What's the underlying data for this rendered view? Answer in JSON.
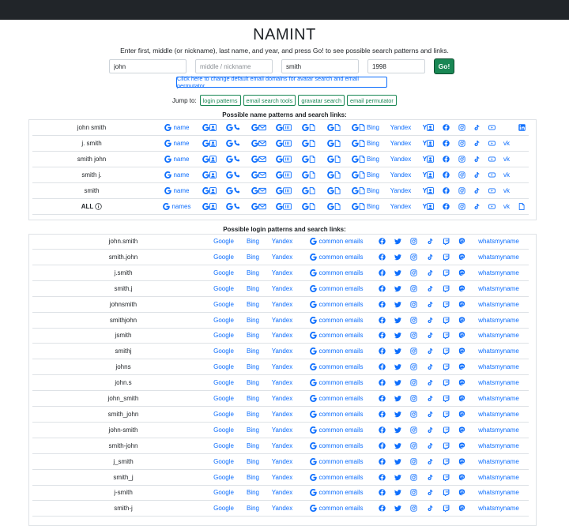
{
  "app": {
    "title": "NAMINT",
    "instructions": "Enter first, middle (or nickname), last name, and year, and press Go! to see possible search patterns and links."
  },
  "form": {
    "first": {
      "value": "john"
    },
    "middle": {
      "value": "",
      "placeholder": "middle / nickname"
    },
    "last": {
      "value": "smith"
    },
    "year": {
      "value": "1998"
    },
    "go_label": "Go!",
    "domain_button": "Click here to change default email domains for avatar search and email permutator"
  },
  "jump": {
    "label": "Jump to:",
    "buttons": [
      "login patterns",
      "email search tools",
      "gravatar search",
      "email permutator"
    ]
  },
  "name_section": {
    "title": "Possible name patterns and search links:",
    "rows": [
      {
        "name": "john smith",
        "g_label": "name",
        "bing": "Bing",
        "yandex": "Yandex",
        "vk": "",
        "last": "linkedin"
      },
      {
        "name": "j. smith",
        "g_label": "name",
        "bing": "Bing",
        "yandex": "Yandex",
        "vk": "vk",
        "last": ""
      },
      {
        "name": "smith john",
        "g_label": "name",
        "bing": "Bing",
        "yandex": "Yandex",
        "vk": "vk",
        "last": ""
      },
      {
        "name": "smith j.",
        "g_label": "name",
        "bing": "Bing",
        "yandex": "Yandex",
        "vk": "vk",
        "last": ""
      },
      {
        "name": "smith",
        "g_label": "name",
        "bing": "Bing",
        "yandex": "Yandex",
        "vk": "vk",
        "last": ""
      },
      {
        "name": "ALL",
        "g_label": "names",
        "bing": "Bing",
        "yandex": "Yandex",
        "vk": "vk",
        "last": "document",
        "bold": true,
        "info": true
      }
    ]
  },
  "login_section": {
    "title": "Possible login patterns and search links:",
    "columns": {
      "google": "Google",
      "bing": "Bing",
      "yandex": "Yandex",
      "emails": "common emails",
      "whats": "whatsmyname"
    },
    "rows": [
      "john.smith",
      "smith.john",
      "j.smith",
      "smith.j",
      "johnsmith",
      "smithjohn",
      "jsmith",
      "smithj",
      "johns",
      "john.s",
      "john_smith",
      "smith_john",
      "john-smith",
      "smith-john",
      "j_smith",
      "smith_j",
      "j-smith",
      "smith-j"
    ]
  },
  "icons": [
    "google-g-icon",
    "google-image-search-icon",
    "phone-icon",
    "email-icon",
    "cv-icon",
    "document-icon",
    "yandex-image-search-icon",
    "facebook-icon",
    "instagram-icon",
    "tiktok-icon",
    "youtube-icon",
    "twitter-icon",
    "mastodon-icon",
    "twitch-icon",
    "linkedin-icon",
    "info-icon"
  ],
  "colors": {
    "link": "#0d6efd",
    "go": "#198754",
    "topbar": "#212529",
    "border": "#dee2e6"
  }
}
